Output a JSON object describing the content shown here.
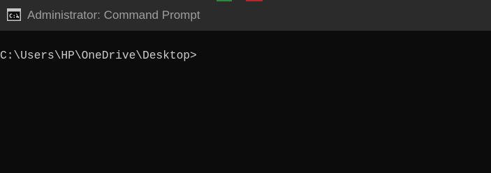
{
  "window": {
    "title": "Administrator: Command Prompt",
    "icon": "command-prompt-icon"
  },
  "terminal": {
    "prompt": "C:\\Users\\HP\\OneDrive\\Desktop>"
  },
  "colors": {
    "titlebar_bg": "#2b2b2b",
    "terminal_bg": "#0c0c0c",
    "title_text": "#9d9d9d",
    "terminal_text": "#cccccc"
  }
}
